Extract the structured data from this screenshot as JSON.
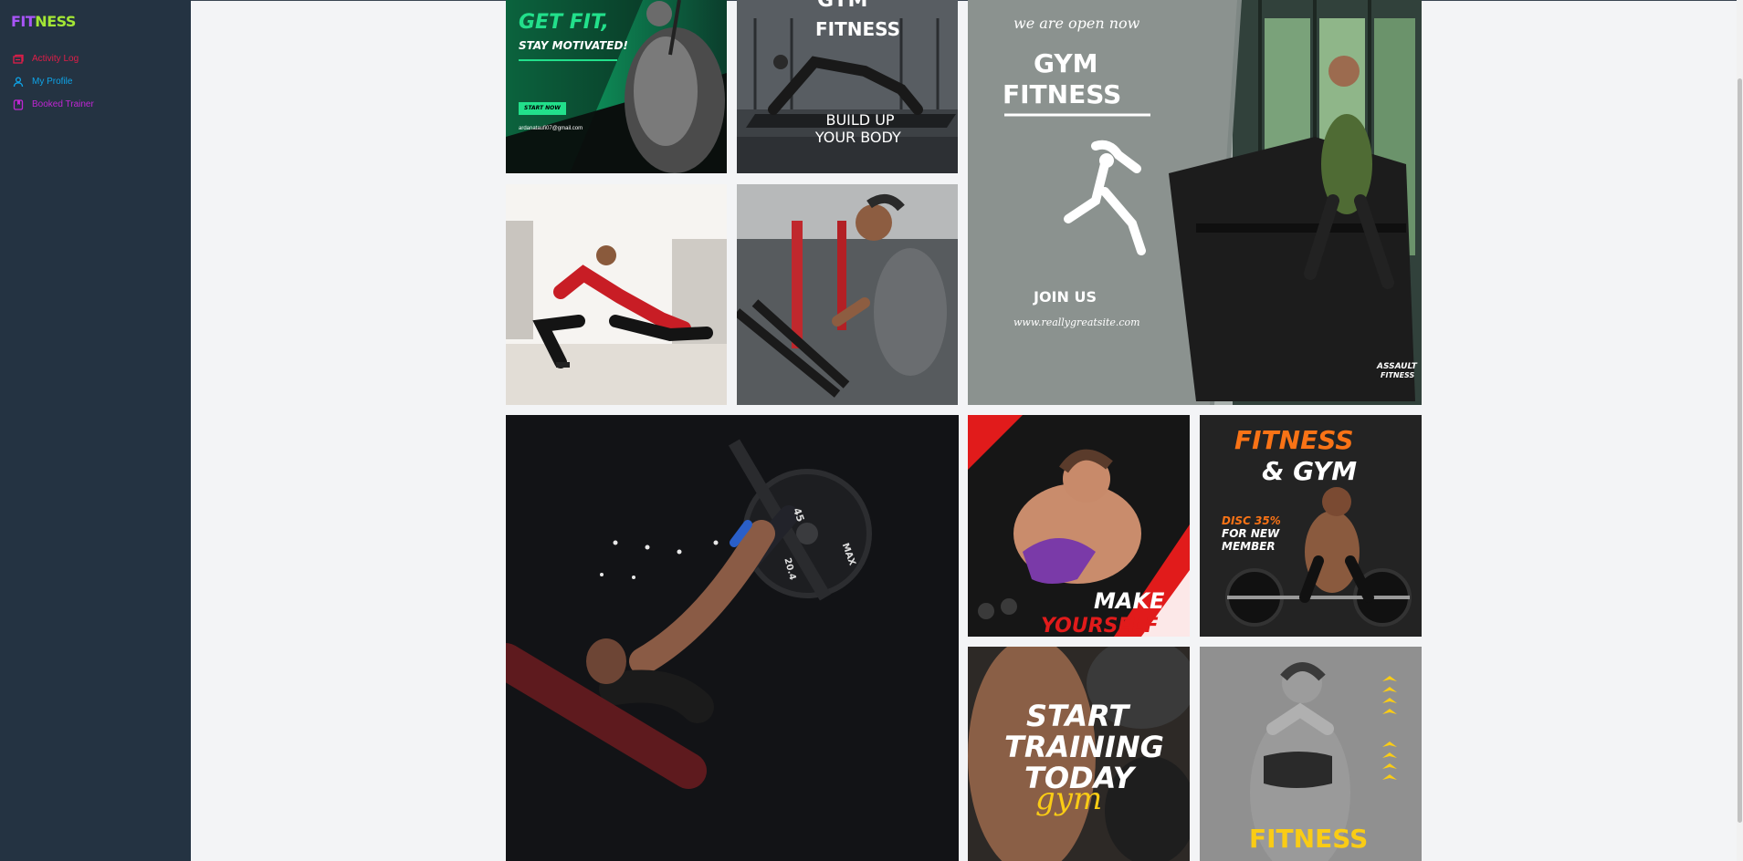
{
  "app": {
    "logo_part1": "FIT",
    "logo_part2": "NESS",
    "logo_color1": "#a855f7",
    "logo_color2": "#a3e635"
  },
  "sidebar": {
    "items": [
      {
        "label": "Activity Log",
        "icon": "activity-log-icon",
        "color": "#e11d48"
      },
      {
        "label": "My Profile",
        "icon": "user-icon",
        "color": "#0ea5e9"
      },
      {
        "label": "Booked Trainer",
        "icon": "bookmark-icon",
        "color": "#c026d3"
      }
    ]
  },
  "gallery": {
    "tile1": {
      "line1": "GET FIT,",
      "line2": "STAY MOTIVATED!",
      "button": "START NOW",
      "email": "ardanataufi07@gmail.com"
    },
    "tile2": {
      "top1": "GYM",
      "top2": "FITNESS",
      "bottom1": "BUILD UP",
      "bottom2": "YOUR BODY"
    },
    "tile3": {
      "open": "we are open now",
      "title1": "GYM",
      "title2": "FITNESS",
      "join": "JOIN US",
      "site": "www.reallygreatsite.com",
      "brand": "ASSAULT",
      "brand2": "FITNESS"
    },
    "tile4": {},
    "tile5": {},
    "tile6": {
      "plate1": "45",
      "plate2": "20.4",
      "plate3": "MAX"
    },
    "tile7": {
      "line1": "MAKE",
      "line2": "YOURSELF"
    },
    "tile8": {
      "line1": "FITNESS",
      "line2": "& GYM",
      "promo1": "DISC 35%",
      "promo2": "FOR NEW",
      "promo3": "MEMBER"
    },
    "tile9": {
      "line1": "START",
      "line2": "TRAINING",
      "line3": "TODAY",
      "script": "gym"
    },
    "tile10": {
      "label": "FITNESS"
    }
  }
}
